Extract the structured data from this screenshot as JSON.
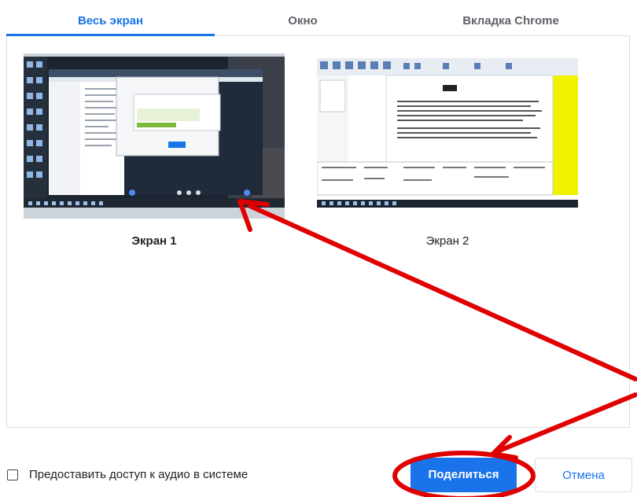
{
  "tabs": [
    {
      "label": "Весь экран",
      "active": true
    },
    {
      "label": "Окно",
      "active": false
    },
    {
      "label": "Вкладка Chrome",
      "active": false
    }
  ],
  "screens": [
    {
      "caption": "Экран 1",
      "selected": true
    },
    {
      "caption": "Экран 2",
      "selected": false
    }
  ],
  "audio_checkbox": {
    "label": "Предоставить доступ к аудио в системе",
    "checked": false
  },
  "buttons": {
    "share": "Поделиться",
    "cancel": "Отмена"
  },
  "colors": {
    "accent": "#1a73e8",
    "annotation": "#e00000",
    "thumb2_yellow": "#ffff00"
  }
}
